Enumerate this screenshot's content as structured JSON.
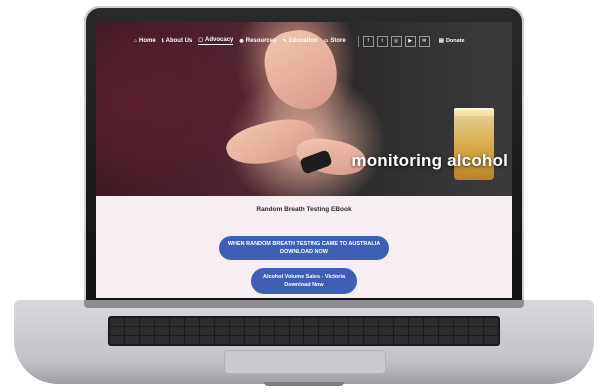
{
  "nav": {
    "items": [
      {
        "label": "Home",
        "icon": "home-icon",
        "active": false
      },
      {
        "label": "About Us",
        "icon": "info-icon",
        "active": false
      },
      {
        "label": "Advocacy",
        "icon": "advocacy-icon",
        "active": true
      },
      {
        "label": "Resources",
        "icon": "eye-icon",
        "active": false
      },
      {
        "label": "Education",
        "icon": "edit-icon",
        "active": false
      },
      {
        "label": "Store",
        "icon": "cart-icon",
        "active": false
      }
    ],
    "social": [
      {
        "icon": "facebook-icon",
        "glyph": "f"
      },
      {
        "icon": "twitter-icon",
        "glyph": "t"
      },
      {
        "icon": "instagram-icon",
        "glyph": "◎"
      },
      {
        "icon": "youtube-icon",
        "glyph": "▶"
      },
      {
        "icon": "email-icon",
        "glyph": "✉"
      }
    ],
    "donate_label": "Donate"
  },
  "hero": {
    "title": "monitoring alcohol"
  },
  "content": {
    "heading": "Random Breath Testing EBook",
    "buttons": [
      {
        "line1": "WHEN RANDOM BREATH TESTING CAME TO AUSTRALIA",
        "line2": "DOWNLOAD NOW"
      },
      {
        "line1": "Alcohol Volume Sales - Victoria",
        "line2": "Download Now"
      }
    ]
  },
  "colors": {
    "button_blue": "#3f5fb5",
    "content_bg": "#f6eef0"
  }
}
